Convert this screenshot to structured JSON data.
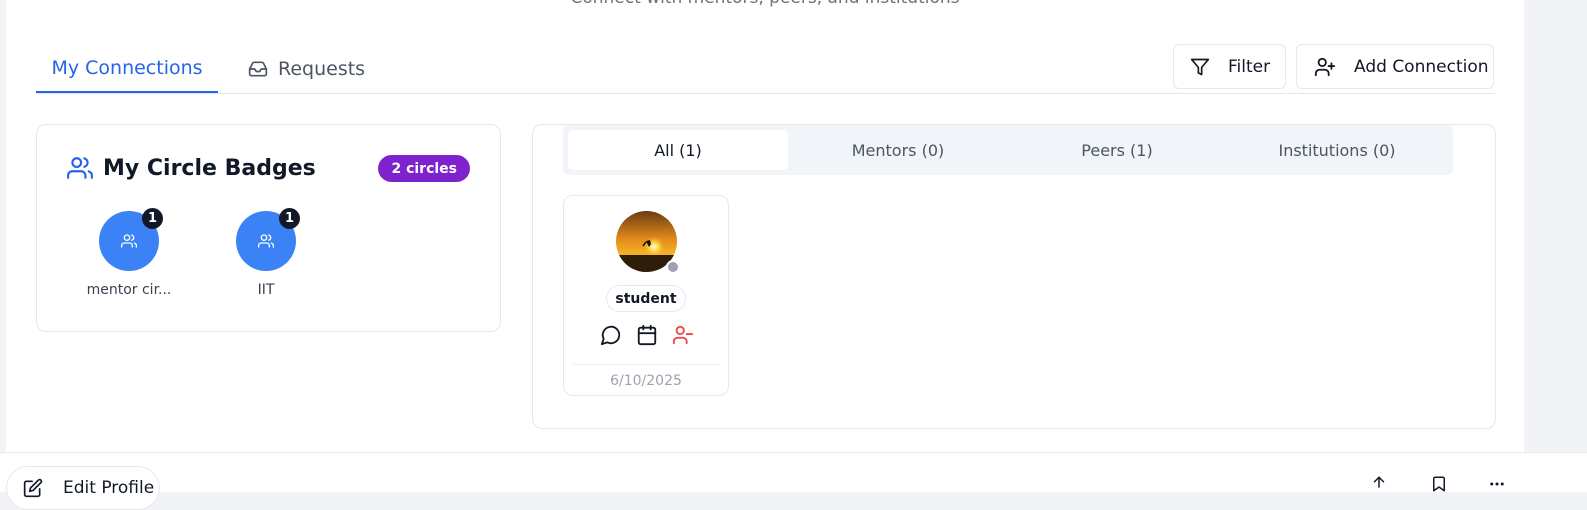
{
  "header": {
    "subtitle": "Connect with mentors, peers, and institutions"
  },
  "tabs": [
    {
      "label": "My Connections",
      "active": true
    },
    {
      "label": "Requests",
      "icon": "inbox-icon"
    }
  ],
  "toolbar": {
    "filter_label": "Filter",
    "add_label": "Add Connection"
  },
  "circle_badges": {
    "title": "My Circle Badges",
    "count_label": "2 circles",
    "items": [
      {
        "label": "mentor cir...",
        "count": "1"
      },
      {
        "label": "IIT",
        "count": "1"
      }
    ]
  },
  "filters": [
    {
      "label": "All (1)",
      "active": true
    },
    {
      "label": "Mentors (0)"
    },
    {
      "label": "Peers (1)"
    },
    {
      "label": "Institutions (0)"
    }
  ],
  "connections": [
    {
      "role": "student",
      "date": "6/10/2025",
      "status": "offline"
    }
  ],
  "bottom": {
    "edit_label": "Edit Profile"
  },
  "colors": {
    "accent": "#2563eb",
    "badge": "#7e22ce",
    "circle": "#3b82f6",
    "remove": "#ef4444"
  }
}
